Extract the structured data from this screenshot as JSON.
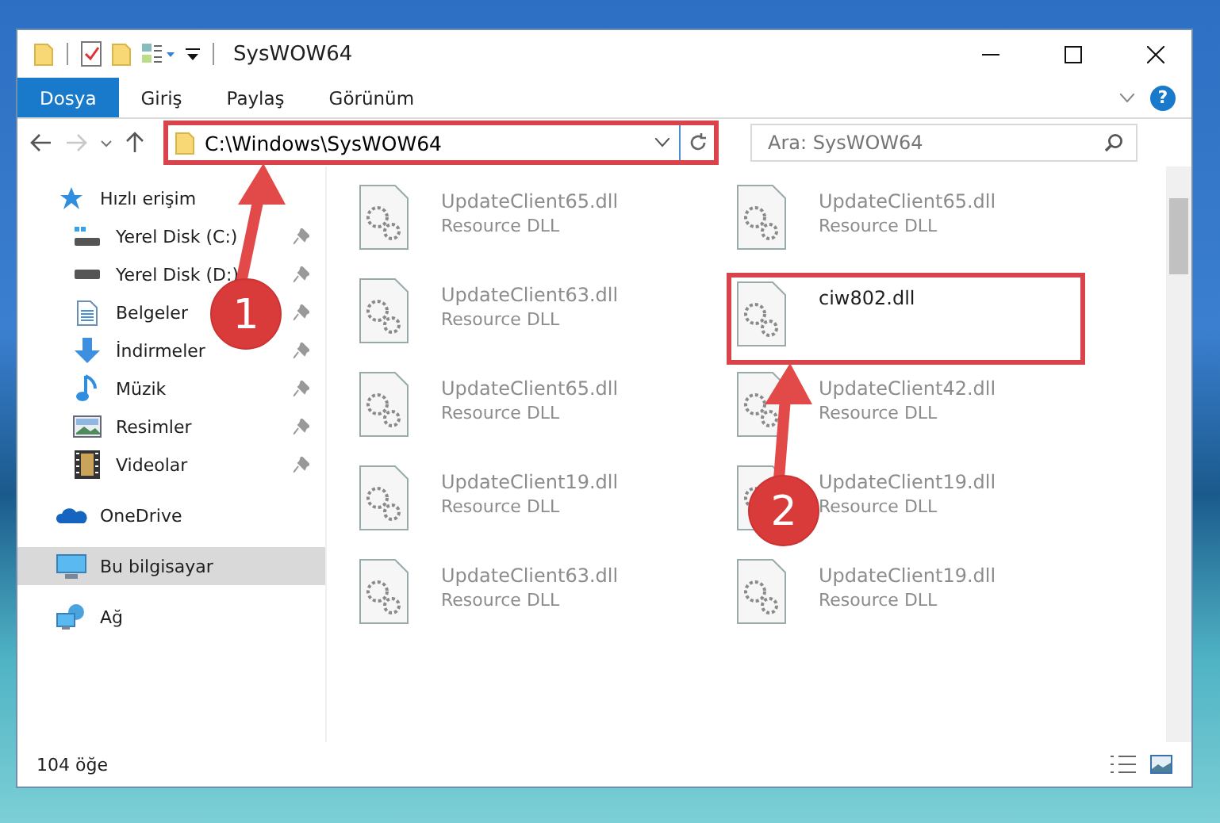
{
  "window": {
    "title": "SysWOW64"
  },
  "ribbon": {
    "tabs": [
      {
        "label": "Dosya",
        "selected": true
      },
      {
        "label": "Giriş",
        "selected": false
      },
      {
        "label": "Paylaş",
        "selected": false
      },
      {
        "label": "Görünüm",
        "selected": false
      }
    ],
    "help": "?"
  },
  "address": {
    "value": "C:\\Windows\\SysWOW64",
    "highlighted": true
  },
  "search": {
    "placeholder": "Ara: SysWOW64"
  },
  "sidebar": {
    "items": [
      {
        "label": "Hızlı erişim",
        "kind": "star",
        "selected": false,
        "children": [
          {
            "label": "Yerel Disk (C:)",
            "kind": "system-drive",
            "pinned": true,
            "selected": false
          },
          {
            "label": "Yerel Disk (D:)",
            "kind": "drive",
            "pinned": true,
            "selected": false
          },
          {
            "label": "Belgeler",
            "kind": "document",
            "pinned": true,
            "selected": false
          },
          {
            "label": "İndirmeler",
            "kind": "download",
            "pinned": true,
            "selected": false
          },
          {
            "label": "Müzik",
            "kind": "music",
            "pinned": true,
            "selected": false
          },
          {
            "label": "Resimler",
            "kind": "picture",
            "pinned": true,
            "selected": false
          },
          {
            "label": "Videolar",
            "kind": "video",
            "pinned": true,
            "selected": false
          }
        ]
      },
      {
        "label": "OneDrive",
        "kind": "cloud",
        "selected": false
      },
      {
        "label": "Bu bilgisayar",
        "kind": "computer",
        "selected": true
      },
      {
        "label": "Ağ",
        "kind": "network",
        "selected": false
      }
    ]
  },
  "files": [
    {
      "name": "UpdateClient65.dll",
      "type": "Resource DLL",
      "faded": true,
      "highlighted": false
    },
    {
      "name": "UpdateClient65.dll",
      "type": "Resource DLL",
      "faded": true,
      "highlighted": false
    },
    {
      "name": "UpdateClient63.dll",
      "type": "Resource DLL",
      "faded": true,
      "highlighted": false
    },
    {
      "name": "ciw802.dll",
      "faded": false,
      "highlighted": true
    },
    {
      "name": "UpdateClient65.dll",
      "type": "Resource DLL",
      "faded": true,
      "highlighted": false
    },
    {
      "name": "UpdateClient42.dll",
      "type": "Resource DLL",
      "faded": true,
      "highlighted": false
    },
    {
      "name": "UpdateClient19.dll",
      "type": "Resource DLL",
      "faded": true,
      "highlighted": false
    },
    {
      "name": "UpdateClient19.dll",
      "type": "Resource DLL",
      "faded": true,
      "highlighted": false
    },
    {
      "name": "UpdateClient63.dll",
      "type": "Resource DLL",
      "faded": true,
      "highlighted": false
    },
    {
      "name": "UpdateClient19.dll",
      "type": "Resource DLL",
      "faded": true,
      "highlighted": false
    }
  ],
  "callouts": [
    {
      "label": "1"
    },
    {
      "label": "2"
    }
  ],
  "status_bar": {
    "count": "104 öğe"
  }
}
